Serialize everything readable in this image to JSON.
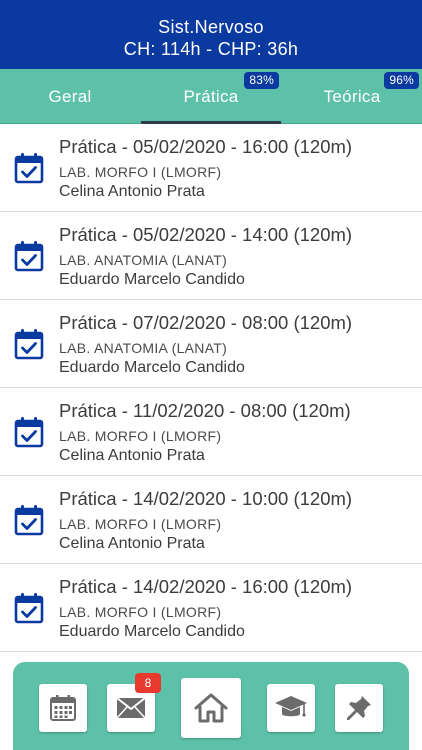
{
  "header": {
    "title": "Sist.Nervoso",
    "subtitle": "CH: 114h - CHP: 36h"
  },
  "tabs": [
    {
      "label": "Geral",
      "badge": "",
      "active": false
    },
    {
      "label": "Prática",
      "badge": "83%",
      "active": true
    },
    {
      "label": "Teórica",
      "badge": "96%",
      "active": false
    }
  ],
  "sessions": [
    {
      "title": "Prática - 05/02/2020 - 16:00 (120m)",
      "location": "LAB. MORFO I (LMORF)",
      "teacher": "Celina Antonio Prata"
    },
    {
      "title": "Prática - 05/02/2020 - 14:00 (120m)",
      "location": "LAB. ANATOMIA (LANAT)",
      "teacher": "Eduardo Marcelo Candido"
    },
    {
      "title": "Prática - 07/02/2020 - 08:00 (120m)",
      "location": "LAB. ANATOMIA (LANAT)",
      "teacher": "Eduardo Marcelo Candido"
    },
    {
      "title": "Prática - 11/02/2020 - 08:00 (120m)",
      "location": "LAB. MORFO I (LMORF)",
      "teacher": "Celina Antonio Prata"
    },
    {
      "title": "Prática - 14/02/2020 - 10:00 (120m)",
      "location": "LAB. MORFO I (LMORF)",
      "teacher": "Celina Antonio Prata"
    },
    {
      "title": "Prática - 14/02/2020 - 16:00 (120m)",
      "location": "LAB. MORFO I (LMORF)",
      "teacher": "Eduardo Marcelo Candido"
    }
  ],
  "dock": {
    "messages_badge": "8",
    "icons": [
      "calendar-icon",
      "mail-icon",
      "home-icon",
      "graduation-cap-icon",
      "pin-icon"
    ]
  },
  "colors": {
    "header": "#0a3aa0",
    "tabs": "#5dc0a8",
    "icon": "#0a3aa0",
    "dock_icon": "#6b6b6b",
    "notification": "#e8392e"
  }
}
